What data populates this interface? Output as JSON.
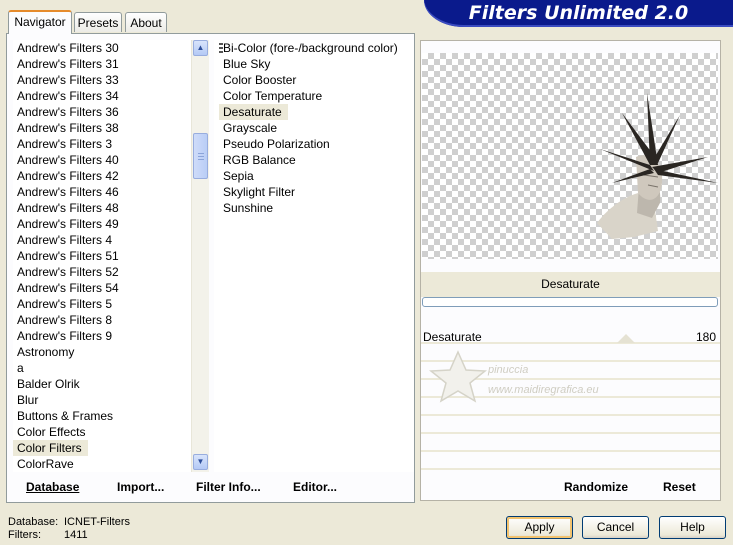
{
  "tabs": [
    "Navigator",
    "Presets",
    "About"
  ],
  "banner_title": "Filters Unlimited 2.0",
  "categories": [
    "Andrew's Filters 30",
    "Andrew's Filters 31",
    "Andrew's Filters 33",
    "Andrew's Filters 34",
    "Andrew's Filters 36",
    "Andrew's Filters 38",
    "Andrew's Filters 3",
    "Andrew's Filters 40",
    "Andrew's Filters 42",
    "Andrew's Filters 46",
    "Andrew's Filters 48",
    "Andrew's Filters 49",
    "Andrew's Filters 4",
    "Andrew's Filters 51",
    "Andrew's Filters 52",
    "Andrew's Filters 54",
    "Andrew's Filters 5",
    "Andrew's Filters 8",
    "Andrew's Filters 9",
    "Astronomy",
    "a",
    "Balder Olrik",
    "Blur",
    "Buttons & Frames",
    "Color Effects",
    "Color Filters",
    "ColorRave"
  ],
  "selected_category": "Color Filters",
  "filters": [
    "Bi-Color (fore-/background color)",
    "Blue Sky",
    "Color Booster",
    "Color Temperature",
    "Desaturate",
    "Grayscale",
    "Pseudo Polarization",
    "RGB Balance",
    "Sepia",
    "Skylight Filter",
    "Sunshine"
  ],
  "selected_filter": "Desaturate",
  "toolbar": {
    "database": "Database",
    "import": "Import...",
    "filter_info": "Filter Info...",
    "editor": "Editor...",
    "randomize": "Randomize",
    "reset": "Reset"
  },
  "preview": {
    "filter_title": "Desaturate",
    "slider_label": "Desaturate",
    "slider_value": "180",
    "slider_fraction": 0.706
  },
  "watermark": {
    "name": "pinuccia",
    "site": "www.maidiregrafica.eu"
  },
  "info": {
    "database_label": "Database:",
    "database_value": "ICNET-Filters",
    "filters_label": "Filters:",
    "filters_value": "1411"
  },
  "buttons": {
    "apply": "Apply",
    "cancel": "Cancel",
    "help": "Help"
  },
  "colors": {
    "banner": "#0a1a8c",
    "dialog_bg": "#ece9d8",
    "selection": "#ece9d8"
  }
}
